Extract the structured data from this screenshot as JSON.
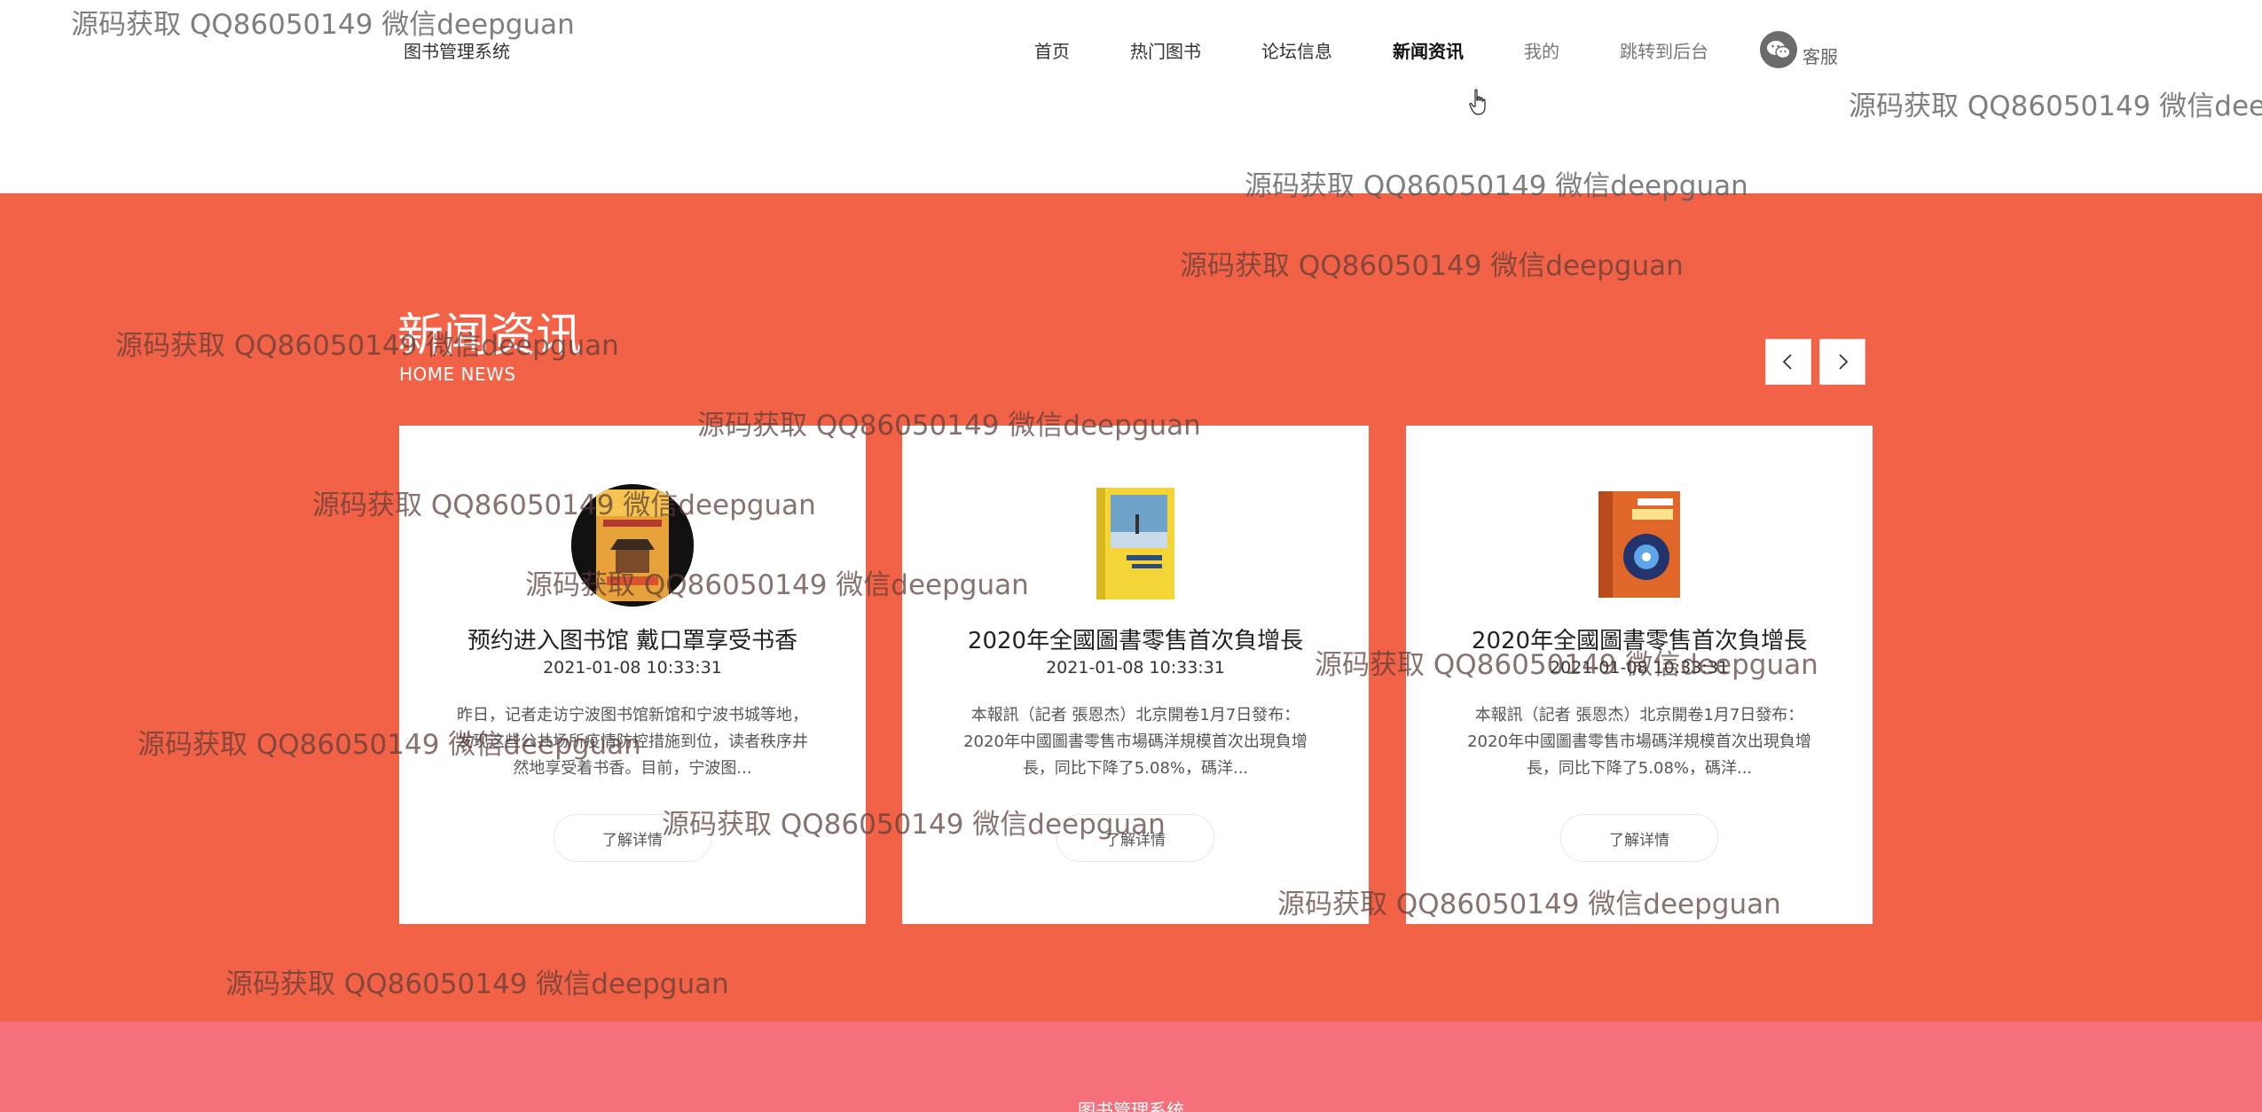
{
  "header": {
    "site_title": "图书管理系统",
    "nav": [
      {
        "label": "首页"
      },
      {
        "label": "热门图书"
      },
      {
        "label": "论坛信息"
      },
      {
        "label": "新闻资讯"
      },
      {
        "label": "我的"
      },
      {
        "label": "跳转到后台"
      }
    ],
    "service_label": "客服"
  },
  "news": {
    "title": "新闻资讯",
    "subtitle": "HOME NEWS",
    "cards": [
      {
        "title": "预约进入图书馆 戴口罩享受书香",
        "date": "2021-01-08 10:33:31",
        "summary": "昨日，记者走访宁波图书馆新馆和宁波书城等地，发现这些公共场所疫情防控措施到位，读者秩序井然地享受着书香。目前，宁波图...",
        "button": "了解详情"
      },
      {
        "title": "2020年全國圖書零售首次負增長",
        "date": "2021-01-08 10:33:31",
        "summary": "本報訊（記者 張恩杰）北京開卷1月7日發布：2020年中國圖書零售市場碼洋規模首次出現負增長，同比下降了5.08%，碼洋...",
        "button": "了解详情"
      },
      {
        "title": "2020年全國圖書零售首次負增長",
        "date": "2021-01-08 10:33:31",
        "summary": "本報訊（記者 張恩杰）北京開卷1月7日發布：2020年中國圖書零售市場碼洋規模首次出現負增長，同比下降了5.08%，碼洋...",
        "button": "了解详情"
      }
    ]
  },
  "footer": {
    "title": "图书管理系统"
  },
  "watermark": "源码获取 QQ86050149 微信deepguan",
  "colors": {
    "news_bg": "#f26247",
    "footer_bg": "#f5707a"
  }
}
